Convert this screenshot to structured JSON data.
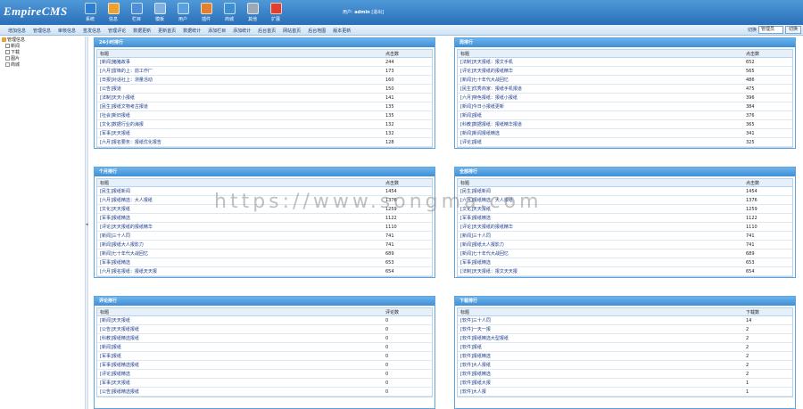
{
  "header": {
    "logo": "EmpireCMS",
    "nav": [
      {
        "label": "系统",
        "icon": "globe-icon",
        "color": "#2f7fd0"
      },
      {
        "label": "信息",
        "icon": "document-icon",
        "color": "#f0a030"
      },
      {
        "label": "栏目",
        "icon": "folder-icon",
        "color": "#4f8fd8"
      },
      {
        "label": "模板",
        "icon": "template-icon",
        "color": "#7fb0e0"
      },
      {
        "label": "用户",
        "icon": "user-icon",
        "color": "#58a0e0"
      },
      {
        "label": "插件",
        "icon": "plugin-icon",
        "color": "#e08030"
      },
      {
        "label": "商城",
        "icon": "shop-icon",
        "color": "#3a90d0"
      },
      {
        "label": "其他",
        "icon": "gear-icon",
        "color": "#9aa8b8"
      },
      {
        "label": "扩展",
        "icon": "extend-icon",
        "color": "#e04030"
      }
    ],
    "user_label": "用户:",
    "username": "admin",
    "logout": "[退出]"
  },
  "subbar": {
    "items": [
      "增加信息",
      "管理信息",
      "审核信息",
      "签发信息",
      "管理评论",
      "数据更新",
      "更新首页",
      "数据统计",
      "添加栏目",
      "添加统计",
      "后台首页",
      "网站首页",
      "后台地图",
      "版本更新"
    ],
    "switch_label": "切换",
    "switch_value": "管理员",
    "switch_button": "切换"
  },
  "tree": [
    {
      "label": "管理信息",
      "icon": "home-icon",
      "indent": 0
    },
    {
      "label": "新闻",
      "icon": "plus-box-icon",
      "indent": 1
    },
    {
      "label": "下载",
      "icon": "plus-box-icon",
      "indent": 1
    },
    {
      "label": "图片",
      "icon": "file-icon",
      "indent": 1
    },
    {
      "label": "商城",
      "icon": "file-icon",
      "indent": 1
    }
  ],
  "panels": {
    "day": {
      "title": "24小时排行",
      "col1": "标题",
      "col2": "点击数",
      "rows": [
        [
          "[新闻]猪猪故事",
          "244"
        ],
        [
          "[六月]雷锋的上：前工作厂",
          "173"
        ],
        [
          "[日报]对话社上：测量活动",
          "160"
        ],
        [
          "[公告]报道",
          "150"
        ],
        [
          "[法制]天天小报纸",
          "141"
        ],
        [
          "[民生]报纸文物考古报道",
          "135"
        ],
        [
          "[社会]新旧报纸",
          "135"
        ],
        [
          "[文化]数据行业的海报",
          "132"
        ],
        [
          "[军事]天天报纸",
          "132"
        ],
        [
          "[六月]报名要务：报纸优化报告",
          "128"
        ]
      ]
    },
    "week": {
      "title": "周排行",
      "col1": "标题",
      "col2": "点击数",
      "rows": [
        [
          "[法制]天天报纸：报文手机",
          "652"
        ],
        [
          "[评论]天天报纸的报纸精华",
          "565"
        ],
        [
          "[新闻]七十年代大战回忆",
          "486"
        ],
        [
          "[民生]优秀商家：报纸手机报道",
          "475"
        ],
        [
          "[六月]特色报纸：报纸小报纸",
          "396"
        ],
        [
          "[新闻]今日小报纸更新",
          "384"
        ],
        [
          "[新闻]报纸",
          "376"
        ],
        [
          "[科教]数据报纸：报纸精华报道",
          "365"
        ],
        [
          "[新闻]新闻报纸精选",
          "341"
        ],
        [
          "[评论]报纸",
          "325"
        ]
      ]
    },
    "month": {
      "title": "个月排行",
      "col1": "标题",
      "col2": "点击数",
      "rows": [
        [
          "[民生]报纸新闻",
          "1454"
        ],
        [
          "[六月]报纸精选：大人报纸",
          "1376"
        ],
        [
          "[文化]天天报纸",
          "1259"
        ],
        [
          "[军事]报纸精选",
          "1122"
        ],
        [
          "[评论]天天报纸的报纸精华",
          "1110"
        ],
        [
          "[新闻]三十人同",
          "741"
        ],
        [
          "[新闻]报纸大人报影力",
          "741"
        ],
        [
          "[新闻]七十年代大战回忆",
          "689"
        ],
        [
          "[军事]报纸精选",
          "653"
        ],
        [
          "[六月]报名报纸：报纸天天报",
          "654"
        ]
      ]
    },
    "all": {
      "title": "全部排行",
      "col1": "标题",
      "col2": "点击数",
      "rows": [
        [
          "[民生]报纸新闻",
          "1454"
        ],
        [
          "[六月]报纸精选：大人报纸",
          "1376"
        ],
        [
          "[文化]天天报纸",
          "1259"
        ],
        [
          "[军事]报纸精选",
          "1122"
        ],
        [
          "[评论]天天报纸的报纸精华",
          "1110"
        ],
        [
          "[新闻]三十人同",
          "741"
        ],
        [
          "[新闻]报纸大人报影力",
          "741"
        ],
        [
          "[新闻]七十年代大战回忆",
          "689"
        ],
        [
          "[军事]报纸精选",
          "653"
        ],
        [
          "[法制]天天报纸：报文天天报",
          "654"
        ]
      ]
    },
    "comments": {
      "title": "评论排行",
      "col1": "标题",
      "col2": "评论数",
      "rows": [
        [
          "[新闻]天天报纸",
          "0"
        ],
        [
          "[公告]天天报纸报纸",
          "0"
        ],
        [
          "[科教]报纸精选报纸",
          "0"
        ],
        [
          "[新闻]报纸",
          "0"
        ],
        [
          "[军事]报纸",
          "0"
        ],
        [
          "[军事]报纸精选报纸",
          "0"
        ],
        [
          "[评论]报纸精选",
          "0"
        ],
        [
          "[军事]天天报纸",
          "0"
        ],
        [
          "[公告]报纸精选报纸",
          "0"
        ]
      ]
    },
    "downloads": {
      "title": "下载排行",
      "col1": "标题",
      "col2": "下载数",
      "rows": [
        [
          "[软件]三十人同",
          "14"
        ],
        [
          "[软件]一天一报",
          "2"
        ],
        [
          "[软件]报纸精选大型报纸",
          "2"
        ],
        [
          "[软件]报纸",
          "2"
        ],
        [
          "[软件]报纸精选",
          "2"
        ],
        [
          "[软件]大人报纸",
          "2"
        ],
        [
          "[软件]报纸精选",
          "2"
        ],
        [
          "[软件]报纸大报",
          "1"
        ],
        [
          "[软件]大人报",
          "1"
        ]
      ]
    }
  },
  "watermark": "https://www.songma.com"
}
